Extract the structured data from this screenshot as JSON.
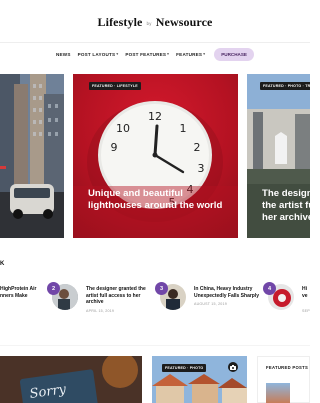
{
  "header": {
    "logo_left": "Lifestyle",
    "logo_mid": "by",
    "logo_right": "Newsource"
  },
  "nav": {
    "items": [
      {
        "label": "NEWS",
        "dropdown": false
      },
      {
        "label": "POST LAYOUTS",
        "dropdown": true
      },
      {
        "label": "POST FEATURES",
        "dropdown": true
      },
      {
        "label": "FEATURES",
        "dropdown": true
      }
    ],
    "purchase_label": "PURCHASE"
  },
  "slider": {
    "center": {
      "tag": "FEATURED · LIFESTYLE",
      "title": "Unique and beautiful lighthouses around the world"
    },
    "right": {
      "tag": "FEATURED · PHOTO · TRAV",
      "title": "The designe the artist ful her archive"
    }
  },
  "week": {
    "label": "K",
    "posts": [
      {
        "number": "",
        "title": "HighProtein Air nners Make",
        "date": ""
      },
      {
        "number": "2",
        "title": "The designer granted the artist full access to her archive",
        "date": "APRIL 15, 2019"
      },
      {
        "number": "3",
        "title": "In China, Heavy Industry Unexpectedly Falls Sharply",
        "date": "AUGUST 15, 2019"
      },
      {
        "number": "4",
        "title": "Hi ve",
        "date": "SEPTE"
      }
    ]
  },
  "bottom": {
    "middle_tag": "FEATURED · PHOTO",
    "sign_text": "Sorry",
    "featured_posts_label": "FEATURED POSTS"
  },
  "colors": {
    "accent": "#7147a8",
    "purchase_bg": "#e3d3ef",
    "red_slide": "#b41222"
  }
}
